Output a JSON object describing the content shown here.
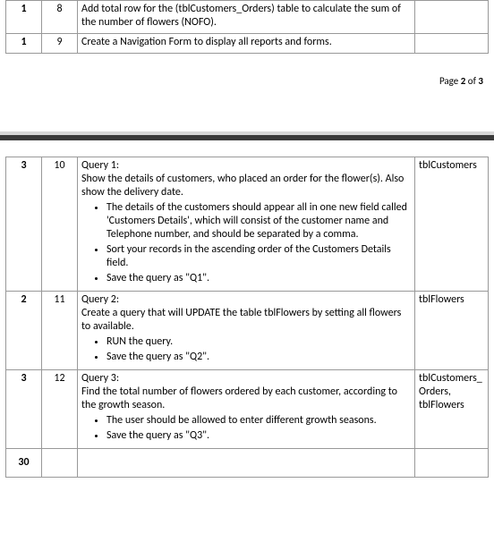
{
  "page_indicator": {
    "prefix": "Page ",
    "current": "2",
    "sep": " of ",
    "total": "3"
  },
  "top_table": {
    "rows": [
      {
        "pts": "1",
        "num": "8",
        "desc": "Add total row for the (tblCustomers_Orders) table to calculate the sum of the number of flowers (NOFO).",
        "ref": ""
      },
      {
        "pts": "1",
        "num": "9",
        "desc": "Create a Navigation Form to display all reports and forms.",
        "ref": ""
      }
    ]
  },
  "bottom_table": {
    "rows": [
      {
        "pts": "3",
        "num": "10",
        "title": "Query 1:",
        "desc": "Show the details of customers, who placed an order for the flower(s). Also show the delivery date.",
        "bullets": [
          "The details of the customers should appear all in one new field called 'Customers Details', which will consist of the customer name and Telephone number, and should be separated by a comma.",
          "Sort your records in the ascending order of the Customers Details field.",
          "Save the query as \"Q1\"."
        ],
        "ref": "tblCustomers"
      },
      {
        "pts": "2",
        "num": "11",
        "title": "Query 2:",
        "desc": "Create a query that will UPDATE the table tblFlowers by setting all flowers to available.",
        "bullets": [
          "RUN the query.",
          "Save the query as \"Q2\"."
        ],
        "ref": "tblFlowers"
      },
      {
        "pts": "3",
        "num": "12",
        "title": "Query 3:",
        "desc": "Find the total number of flowers ordered by each customer, according to the growth season.",
        "bullets": [
          "The user should be allowed to enter different growth seasons.",
          "Save the query as \"Q3\"."
        ],
        "ref": "tblCustomers_Orders, tblFlowers"
      },
      {
        "pts": "30",
        "num": "",
        "title": "",
        "desc": "",
        "bullets": [],
        "ref": ""
      }
    ]
  }
}
